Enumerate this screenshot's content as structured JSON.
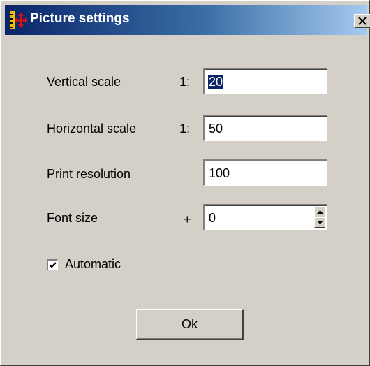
{
  "window": {
    "title": "Picture settings",
    "icon": "move-arrows-icon",
    "close_label": "close"
  },
  "form": {
    "vertical_scale": {
      "label": "Vertical scale",
      "prefix": "1:",
      "value": "20",
      "selected": true
    },
    "horizontal_scale": {
      "label": "Horizontal scale",
      "prefix": "1:",
      "value": "50"
    },
    "print_resolution": {
      "label": "Print resolution",
      "value": "100"
    },
    "font_size": {
      "label": "Font size",
      "prefix": "+",
      "value": "0"
    },
    "automatic": {
      "label": "Automatic",
      "checked": true
    }
  },
  "buttons": {
    "ok_label": "Ok"
  },
  "colors": {
    "dialog_bg": "#d4d0c8",
    "titlebar_start": "#0a246a",
    "titlebar_end": "#a6caf0",
    "selection": "#0a246a",
    "icon_red": "#e01010",
    "icon_yellow": "#f0c000"
  }
}
